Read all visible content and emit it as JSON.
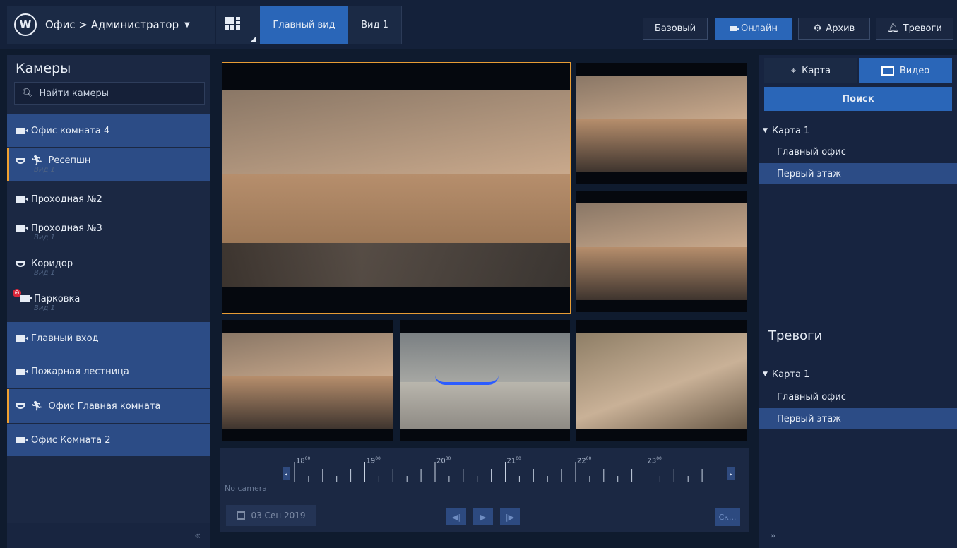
{
  "topbar": {
    "site_title": "Офис > Администратор",
    "tabs": [
      {
        "label": "Главный вид"
      },
      {
        "label": "Вид 1"
      }
    ],
    "modes": [
      {
        "label": "Базовый"
      },
      {
        "label": "Онлайн"
      },
      {
        "label": "Архив"
      },
      {
        "label": "Тревоги"
      }
    ],
    "active_mode": "Онлайн"
  },
  "cameras": {
    "title": "Камеры",
    "search_placeholder": "Найти камеры",
    "items": [
      {
        "label": "Офис комната 4",
        "sub": "",
        "icon": "camera-icon",
        "selected": true
      },
      {
        "label": "Ресепшн",
        "sub": "Вид 1",
        "icon": "dome-camera-icon",
        "selected": true,
        "motion": true
      },
      {
        "label": "Проходная №2",
        "sub": "",
        "icon": "camera-icon"
      },
      {
        "label": "Проходная №3",
        "sub": "Вид 1",
        "icon": "camera-icon"
      },
      {
        "label": "Коридор",
        "sub": "Вид 1",
        "icon": "dome-camera-icon"
      },
      {
        "label": "Парковка",
        "sub": "Вид 1",
        "icon": "camera-disabled-icon"
      },
      {
        "label": "Главный вход",
        "sub": "",
        "icon": "camera-icon",
        "selected": true
      },
      {
        "label": "Пожарная лестница",
        "sub": "",
        "icon": "camera-icon",
        "selected": true
      },
      {
        "label": "Офис Главная комната",
        "sub": "",
        "icon": "dome-camera-icon",
        "selected": true,
        "motion": true
      },
      {
        "label": "Офис Комната 2",
        "sub": "",
        "icon": "camera-icon",
        "selected": true
      }
    ],
    "collapse": "«"
  },
  "timeline": {
    "hours": [
      "18",
      "19",
      "20",
      "21",
      "22",
      "23"
    ],
    "minutes": "00",
    "no_camera": "No camera",
    "date": "03 Сен 2019",
    "sk_label": "Ск..."
  },
  "right": {
    "tabs": [
      {
        "label": "Карта"
      },
      {
        "label": "Видео"
      }
    ],
    "active_tab": "Видео",
    "search_label": "Поиск",
    "maps": {
      "root": "Карта 1",
      "items": [
        "Главный офис",
        "Первый этаж"
      ],
      "selected": "Первый этаж"
    },
    "alarms_title": "Тревоги",
    "alarms": {
      "root": "Карта 1",
      "items": [
        "Главный офис",
        "Первый этаж"
      ],
      "selected": "Первый этаж"
    },
    "collapse": "»"
  },
  "colors": {
    "accent": "#2a66b8",
    "focus": "#e79c35",
    "motion": "#f0a030",
    "error": "#d9263a"
  }
}
